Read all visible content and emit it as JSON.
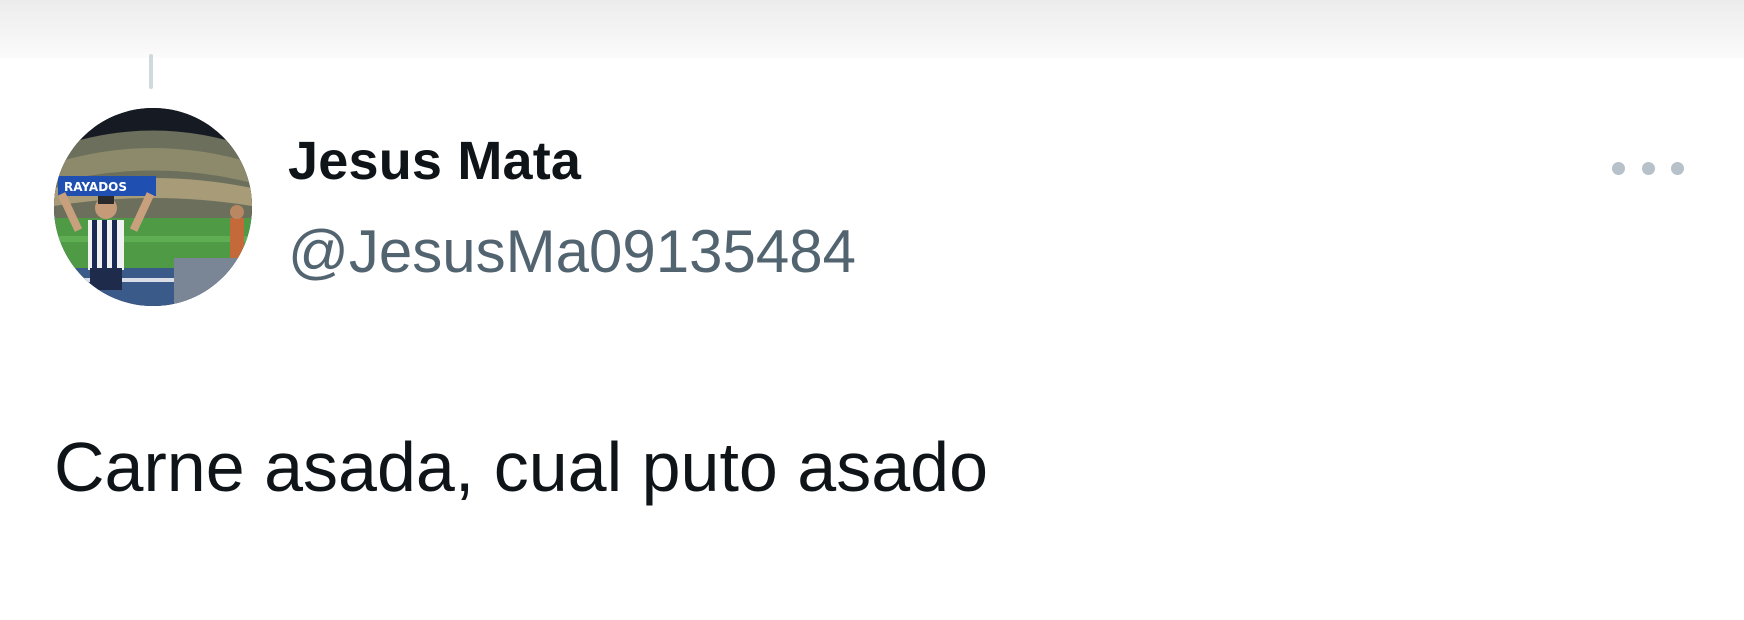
{
  "tweet": {
    "author": {
      "display_name": "Jesus Mata",
      "handle": "@JesusMa09135484",
      "avatar_icon": "user-avatar-stadium-photo"
    },
    "text": "Carne asada, cual puto asado",
    "more_icon": "more-horizontal-icon"
  },
  "colors": {
    "text_primary": "#0f1419",
    "text_secondary": "#536471",
    "thread_line": "#cfd9de",
    "more_dots": "#b6c1c9"
  }
}
